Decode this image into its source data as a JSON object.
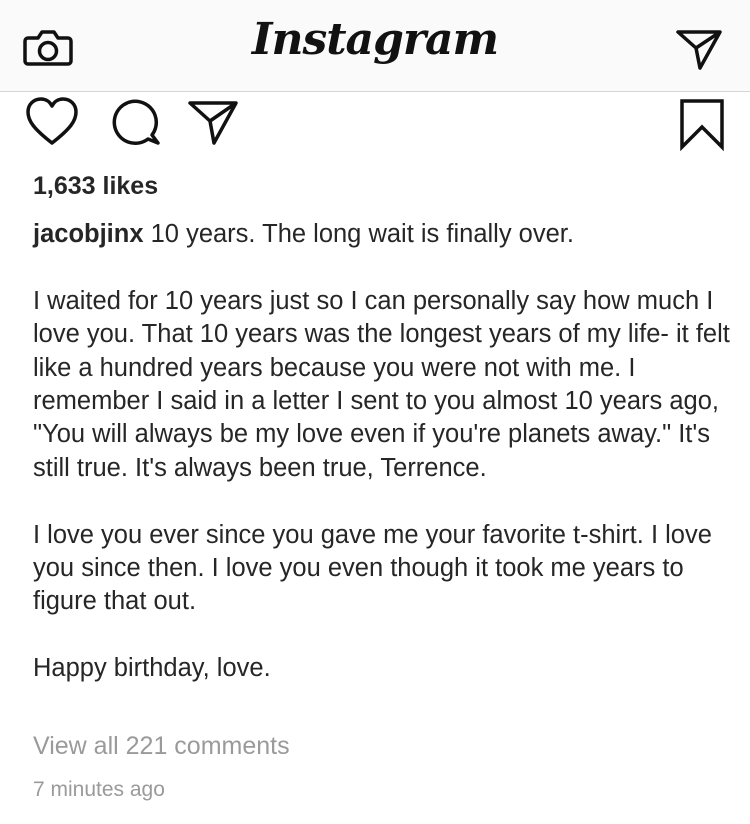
{
  "header": {
    "title": "Instagram",
    "camera_icon": "camera-icon",
    "direct_icon": "paper-plane-icon"
  },
  "actions": {
    "like_icon": "heart-icon",
    "comment_icon": "comment-icon",
    "share_icon": "paper-plane-icon",
    "save_icon": "bookmark-icon"
  },
  "post": {
    "likes": "1,633 likes",
    "username": "jacobjinx",
    "caption_first_line": " 10 years. The long wait is finally over.",
    "paragraphs": [
      "I waited for 10 years just so I can personally say how much I love you. That 10 years was the longest years of my life- it felt like a hundred years because you were not with me. I remember I said in a letter I sent to you almost 10 years ago, \"You will always be my love even if you're planets away.\" It's still true. It's always been true, Terrence.",
      "I love you ever since you gave me your favorite t-shirt. I love you since then. I love you even though it took me years to figure that out.",
      "Happy birthday, love."
    ],
    "view_comments": "View all 221 comments",
    "timestamp": "7 minutes ago"
  },
  "colors": {
    "text": "#262626",
    "muted": "#9a9a9a",
    "header_bg": "#fafafa",
    "divider": "#d6d6d6"
  }
}
